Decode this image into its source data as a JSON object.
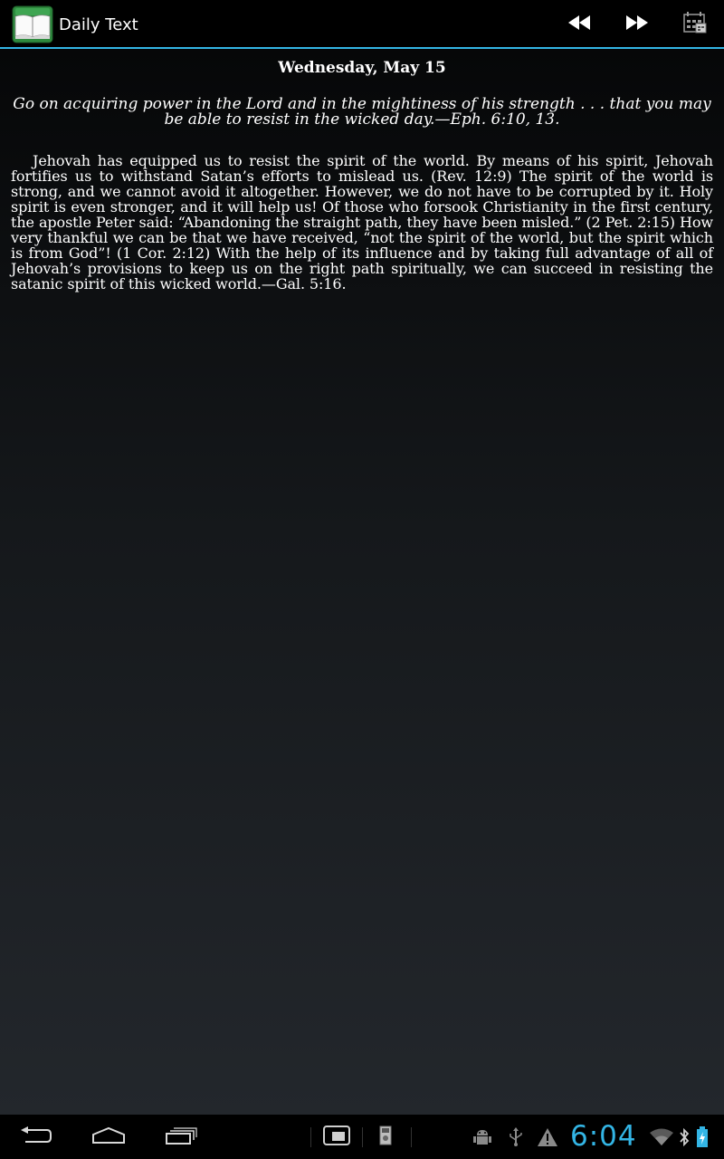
{
  "action_bar": {
    "title": "Daily Text",
    "icons": [
      "book-icon",
      "rewind-icon",
      "fast-forward-icon",
      "calendar-icon"
    ]
  },
  "daily_text": {
    "date": "Wednesday, May 15",
    "scripture": "Go on acquiring power in the Lord and in the mightiness of his strength . . . that you may be able to resist in the wicked day.—Eph. 6:10, 13.",
    "comment": "Jehovah has equipped us to resist the spirit of the world. By means of his spirit, Jehovah fortifies us to withstand Satan’s efforts to mislead us. (Rev. 12:9) The spirit of the world is strong, and we cannot avoid it altogether. However, we do not have to be corrupted by it. Holy spirit is even stronger, and it will help us! Of those who forsook Christianity in the first century, the apostle Peter said: “Abandoning the straight path, they have been misled.” (2 Pet. 2:15) How very thankful we can be that we have received, “not the spirit of the world, but the spirit which is from God”! (1 Cor. 2:12) With the help of its influence and by taking full advantage of all of Jehovah’s provisions to keep us on the right path spiritually, we can succeed in resisting the satanic spirit of this wicked world.—Gal. 5:16."
  },
  "system_bar": {
    "clock": "6:04",
    "nav_icons": [
      "back-icon",
      "home-icon",
      "recent-apps-icon"
    ],
    "status_icons": [
      "screenshot-icon",
      "sd-card-icon",
      "android-debug-icon",
      "usb-icon",
      "warning-icon",
      "wifi-icon",
      "bluetooth-icon",
      "battery-charging-icon"
    ]
  },
  "colors": {
    "accent": "#33b5e5",
    "app_icon_green": "#2e8b3e"
  }
}
